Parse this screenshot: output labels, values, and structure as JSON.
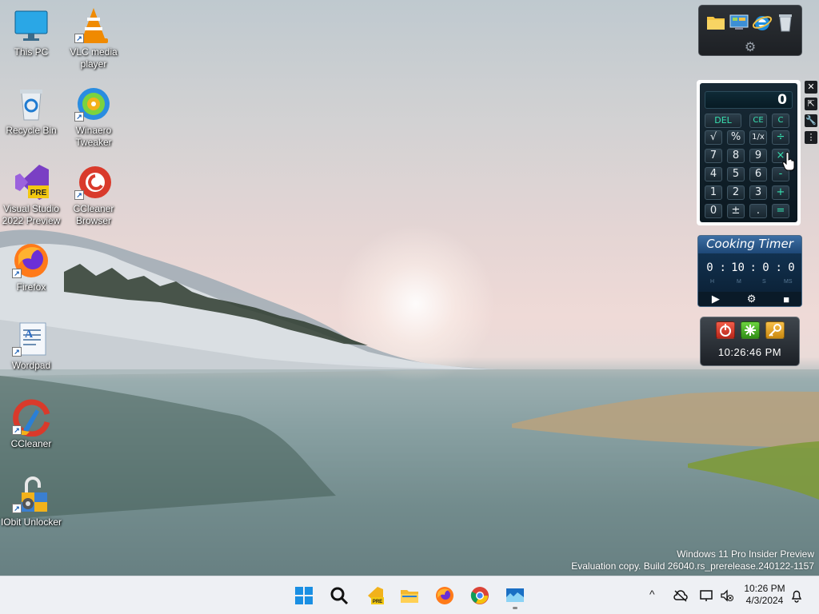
{
  "desktop": {
    "icons": [
      {
        "label": "This PC",
        "icon": "monitor-icon"
      },
      {
        "label": "VLC media player",
        "icon": "vlc-icon"
      },
      {
        "label": "Recycle Bin",
        "icon": "recycle-bin-icon"
      },
      {
        "label": "Winaero Tweaker",
        "icon": "winaero-icon"
      },
      {
        "label": "Visual Studio 2022 Preview",
        "icon": "visual-studio-icon",
        "badge": "PRE"
      },
      {
        "label": "CCleaner Browser",
        "icon": "ccleaner-browser-icon"
      },
      {
        "label": "Firefox",
        "icon": "firefox-icon"
      },
      {
        "label": "Wordpad",
        "icon": "wordpad-icon"
      },
      {
        "label": "CCleaner",
        "icon": "ccleaner-icon"
      },
      {
        "label": "IObit Unlocker",
        "icon": "iobit-unlocker-icon"
      }
    ],
    "watermark": {
      "line1": "Windows 11 Pro Insider Preview",
      "line2": "Evaluation copy. Build 26040.rs_prerelease.240122-1157"
    }
  },
  "gadgets": {
    "launcher": {
      "items": [
        "folder-icon",
        "control-panel-icon",
        "internet-explorer-icon",
        "recycle-bin-icon"
      ],
      "settings_icon": "gear-icon"
    },
    "calculator": {
      "display": "0",
      "keys": {
        "del": "DEL",
        "ce": "CE",
        "c": "C",
        "sqrt": "√",
        "percent": "%",
        "reciprocal": "1/x",
        "divide": "÷",
        "d7": "7",
        "d8": "8",
        "d9": "9",
        "multiply": "×",
        "d4": "4",
        "d5": "5",
        "d6": "6",
        "minus": "-",
        "d1": "1",
        "d2": "2",
        "d3": "3",
        "plus": "+",
        "d0": "0",
        "sign": "±",
        "dot": ".",
        "equals": "="
      },
      "side": {
        "close": "✕",
        "size": "⇱",
        "options": "🔧",
        "drag": "⋮"
      }
    },
    "cooking_timer": {
      "title": "Cooking Timer",
      "hours": "0",
      "minutes": "10",
      "seconds": "0",
      "ms": "0",
      "unit_h": "H",
      "unit_m": "M",
      "unit_s": "S",
      "unit_ms": "MS",
      "controls": {
        "play": "▶",
        "settings": "⚙",
        "stop": "■"
      }
    },
    "clock": {
      "time": "10:26:46 PM",
      "buttons": [
        "power-icon",
        "restart-icon",
        "key-icon"
      ]
    }
  },
  "taskbar": {
    "apps": [
      "start-icon",
      "search-icon",
      "visual-studio-icon",
      "file-explorer-icon",
      "firefox-icon",
      "chrome-icon",
      "gadgets-icon"
    ],
    "tray": {
      "chevron": "^"
    },
    "clock": {
      "time": "10:26 PM",
      "date": "4/3/2024"
    }
  }
}
